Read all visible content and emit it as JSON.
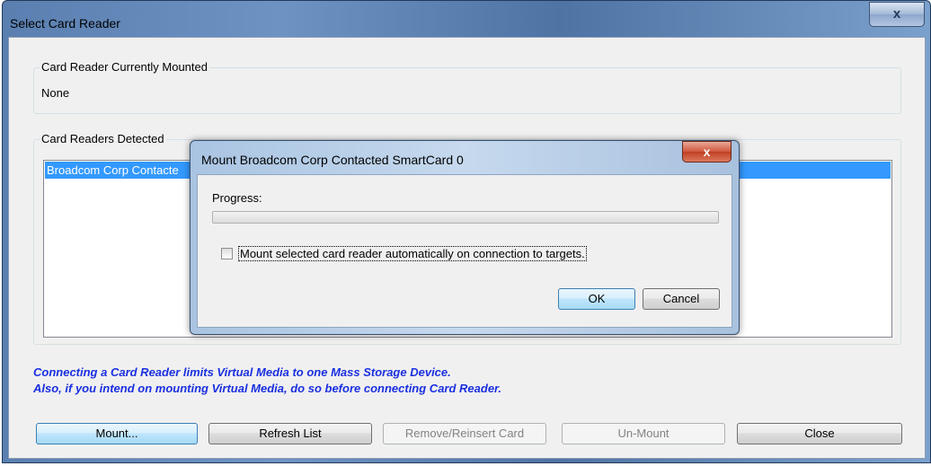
{
  "window": {
    "title": "Select Card Reader",
    "close_glyph": "x"
  },
  "mounted_group": {
    "caption": "Card Reader Currently Mounted",
    "value": "None"
  },
  "detected_group": {
    "caption": "Card Readers Detected",
    "items": [
      "Broadcom Corp Contacte"
    ],
    "selected_index": 0
  },
  "info_lines": [
    "Connecting a Card Reader limits Virtual Media to one Mass Storage Device.",
    "Also, if you intend on mounting Virtual Media, do so before connecting Card Reader."
  ],
  "buttons": {
    "mount": "Mount...",
    "refresh": "Refresh List",
    "remove": "Remove/Reinsert Card",
    "unmount": "Un-Mount",
    "close": "Close"
  },
  "dialog": {
    "title": "Mount Broadcom Corp Contacted SmartCard 0",
    "close_glyph": "x",
    "progress_label": "Progress:",
    "progress_value": 0,
    "checkbox_label": "Mount selected card reader automatically on connection to targets.",
    "checkbox_checked": false,
    "ok": "OK",
    "cancel": "Cancel"
  },
  "colors": {
    "selection": "#3399ff",
    "info_text": "#1a2fe0"
  }
}
